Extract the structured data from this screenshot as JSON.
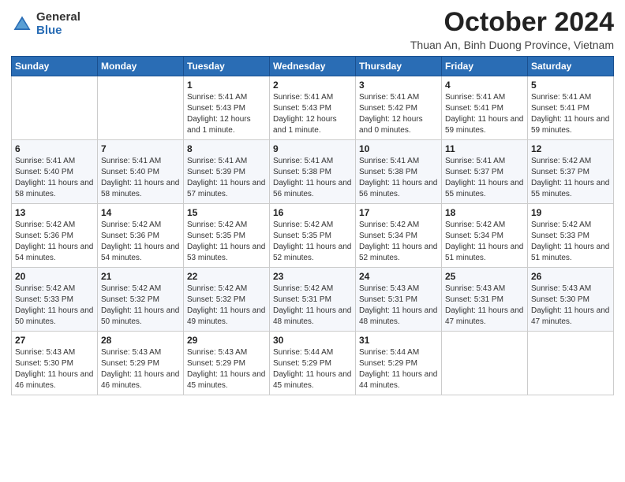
{
  "logo": {
    "general": "General",
    "blue": "Blue"
  },
  "header": {
    "title": "October 2024",
    "subtitle": "Thuan An, Binh Duong Province, Vietnam"
  },
  "weekdays": [
    "Sunday",
    "Monday",
    "Tuesday",
    "Wednesday",
    "Thursday",
    "Friday",
    "Saturday"
  ],
  "weeks": [
    [
      {
        "day": "",
        "info": ""
      },
      {
        "day": "",
        "info": ""
      },
      {
        "day": "1",
        "info": "Sunrise: 5:41 AM\nSunset: 5:43 PM\nDaylight: 12 hours and 1 minute."
      },
      {
        "day": "2",
        "info": "Sunrise: 5:41 AM\nSunset: 5:43 PM\nDaylight: 12 hours and 1 minute."
      },
      {
        "day": "3",
        "info": "Sunrise: 5:41 AM\nSunset: 5:42 PM\nDaylight: 12 hours and 0 minutes."
      },
      {
        "day": "4",
        "info": "Sunrise: 5:41 AM\nSunset: 5:41 PM\nDaylight: 11 hours and 59 minutes."
      },
      {
        "day": "5",
        "info": "Sunrise: 5:41 AM\nSunset: 5:41 PM\nDaylight: 11 hours and 59 minutes."
      }
    ],
    [
      {
        "day": "6",
        "info": "Sunrise: 5:41 AM\nSunset: 5:40 PM\nDaylight: 11 hours and 58 minutes."
      },
      {
        "day": "7",
        "info": "Sunrise: 5:41 AM\nSunset: 5:40 PM\nDaylight: 11 hours and 58 minutes."
      },
      {
        "day": "8",
        "info": "Sunrise: 5:41 AM\nSunset: 5:39 PM\nDaylight: 11 hours and 57 minutes."
      },
      {
        "day": "9",
        "info": "Sunrise: 5:41 AM\nSunset: 5:38 PM\nDaylight: 11 hours and 56 minutes."
      },
      {
        "day": "10",
        "info": "Sunrise: 5:41 AM\nSunset: 5:38 PM\nDaylight: 11 hours and 56 minutes."
      },
      {
        "day": "11",
        "info": "Sunrise: 5:41 AM\nSunset: 5:37 PM\nDaylight: 11 hours and 55 minutes."
      },
      {
        "day": "12",
        "info": "Sunrise: 5:42 AM\nSunset: 5:37 PM\nDaylight: 11 hours and 55 minutes."
      }
    ],
    [
      {
        "day": "13",
        "info": "Sunrise: 5:42 AM\nSunset: 5:36 PM\nDaylight: 11 hours and 54 minutes."
      },
      {
        "day": "14",
        "info": "Sunrise: 5:42 AM\nSunset: 5:36 PM\nDaylight: 11 hours and 54 minutes."
      },
      {
        "day": "15",
        "info": "Sunrise: 5:42 AM\nSunset: 5:35 PM\nDaylight: 11 hours and 53 minutes."
      },
      {
        "day": "16",
        "info": "Sunrise: 5:42 AM\nSunset: 5:35 PM\nDaylight: 11 hours and 52 minutes."
      },
      {
        "day": "17",
        "info": "Sunrise: 5:42 AM\nSunset: 5:34 PM\nDaylight: 11 hours and 52 minutes."
      },
      {
        "day": "18",
        "info": "Sunrise: 5:42 AM\nSunset: 5:34 PM\nDaylight: 11 hours and 51 minutes."
      },
      {
        "day": "19",
        "info": "Sunrise: 5:42 AM\nSunset: 5:33 PM\nDaylight: 11 hours and 51 minutes."
      }
    ],
    [
      {
        "day": "20",
        "info": "Sunrise: 5:42 AM\nSunset: 5:33 PM\nDaylight: 11 hours and 50 minutes."
      },
      {
        "day": "21",
        "info": "Sunrise: 5:42 AM\nSunset: 5:32 PM\nDaylight: 11 hours and 50 minutes."
      },
      {
        "day": "22",
        "info": "Sunrise: 5:42 AM\nSunset: 5:32 PM\nDaylight: 11 hours and 49 minutes."
      },
      {
        "day": "23",
        "info": "Sunrise: 5:42 AM\nSunset: 5:31 PM\nDaylight: 11 hours and 48 minutes."
      },
      {
        "day": "24",
        "info": "Sunrise: 5:43 AM\nSunset: 5:31 PM\nDaylight: 11 hours and 48 minutes."
      },
      {
        "day": "25",
        "info": "Sunrise: 5:43 AM\nSunset: 5:31 PM\nDaylight: 11 hours and 47 minutes."
      },
      {
        "day": "26",
        "info": "Sunrise: 5:43 AM\nSunset: 5:30 PM\nDaylight: 11 hours and 47 minutes."
      }
    ],
    [
      {
        "day": "27",
        "info": "Sunrise: 5:43 AM\nSunset: 5:30 PM\nDaylight: 11 hours and 46 minutes."
      },
      {
        "day": "28",
        "info": "Sunrise: 5:43 AM\nSunset: 5:29 PM\nDaylight: 11 hours and 46 minutes."
      },
      {
        "day": "29",
        "info": "Sunrise: 5:43 AM\nSunset: 5:29 PM\nDaylight: 11 hours and 45 minutes."
      },
      {
        "day": "30",
        "info": "Sunrise: 5:44 AM\nSunset: 5:29 PM\nDaylight: 11 hours and 45 minutes."
      },
      {
        "day": "31",
        "info": "Sunrise: 5:44 AM\nSunset: 5:29 PM\nDaylight: 11 hours and 44 minutes."
      },
      {
        "day": "",
        "info": ""
      },
      {
        "day": "",
        "info": ""
      }
    ]
  ]
}
